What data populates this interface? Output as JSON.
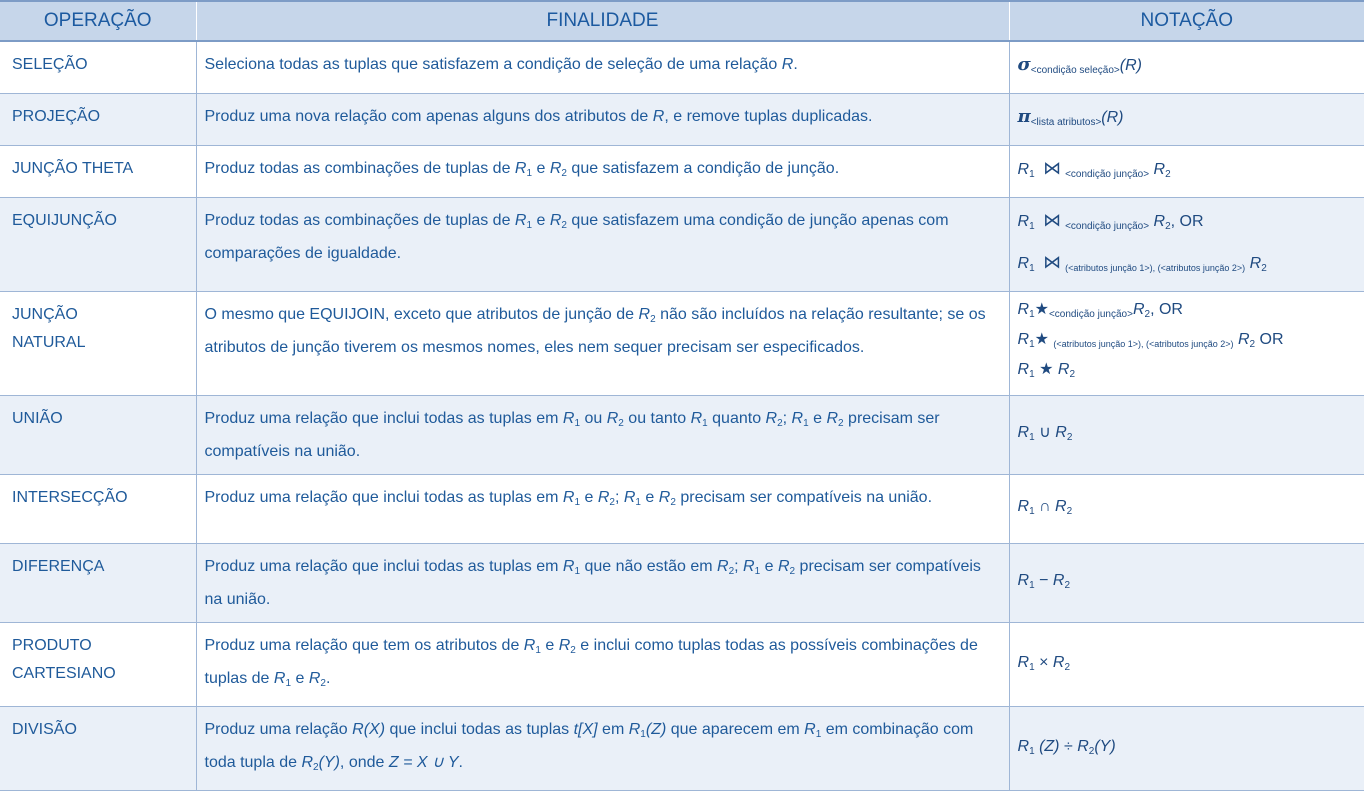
{
  "headers": {
    "operation": "OPERAÇÃO",
    "purpose": "FINALIDADE",
    "notation": "NOTAÇÃO"
  },
  "symbols": {
    "r": "R",
    "one": "1",
    "two": "2",
    "sigma": "σ",
    "pi": "π",
    "join": "⋈",
    "star": "★",
    "union": "∪",
    "intersect": "∩",
    "minus": "−",
    "times": "×",
    "div": "÷"
  },
  "rows": [
    {
      "op": "SELEÇÃO",
      "purpose": {
        "a": "Seleciona todas as tuplas que satisfazem a condição de seleção de uma relação ",
        "b": "."
      },
      "notation": {
        "sub": "<condição seleção>",
        "arg": "(R)"
      }
    },
    {
      "op": "PROJEÇÃO",
      "purpose": {
        "a": "Produz uma nova relação com apenas alguns dos atributos de ",
        "b": ", e remove tuplas duplicadas."
      },
      "notation": {
        "sub": "<lista atributos>",
        "arg": "(R)"
      }
    },
    {
      "op": "JUNÇÃO THETA",
      "purpose": {
        "a": "Produz todas as combinações de tuplas de ",
        "b": " e ",
        "c": " que satisfazem a condição de junção."
      },
      "notation": {
        "sub": "<condição junção>"
      }
    },
    {
      "op": "EQUIJUNÇÃO",
      "purpose": {
        "a": "Produz todas as combinações de tuplas de ",
        "b": " e ",
        "c": " que satisfazem uma condição de junção apenas com comparações de igualdade."
      },
      "notation": {
        "sub1": "<condição junção>",
        "or": ", OR",
        "sub2": "(<atributos junção 1>), (<atributos junção 2>)"
      }
    },
    {
      "op1": "JUNÇÃO",
      "op2": "NATURAL",
      "purpose": {
        "a": "O mesmo que EQUIJOIN, exceto que atributos de junção de ",
        "b": " não são incluídos na relação resultante; se os atributos de junção tiverem os mesmos nomes, eles nem sequer precisam ser especificados."
      },
      "notation": {
        "sub1": "<condição junção>",
        "or1": ", OR",
        "sub2": "(<atributos junção 1>), (<atributos junção 2>)",
        "or2": " OR"
      }
    },
    {
      "op": "UNIÃO",
      "purpose": {
        "a": "Produz uma relação que inclui todas as tuplas em ",
        "b": " ou ",
        "c": " ou tanto ",
        "d": " quanto ",
        "e": "; ",
        "f": " e ",
        "g": " precisam ser compatíveis na união."
      }
    },
    {
      "op": "INTERSECÇÃO",
      "purpose": {
        "a": "Produz uma relação que inclui todas as tuplas em ",
        "b": " e ",
        "c": "; ",
        "d": " e ",
        "e": " precisam ser compatíveis na união."
      }
    },
    {
      "op": "DIFERENÇA",
      "purpose": {
        "a": "Produz uma relação que inclui todas as tuplas em ",
        "b": " que não estão em ",
        "c": "; ",
        "d": " e ",
        "e": " precisam ser compatíveis na união."
      }
    },
    {
      "op1": "PRODUTO",
      "op2": "CARTESIANO",
      "purpose": {
        "a": "Produz uma relação que tem os atributos de ",
        "b": " e ",
        "c": " e inclui como tuplas todas as possíveis combinações de tuplas de ",
        "d": " e ",
        "e": "."
      }
    },
    {
      "op": "DIVISÃO",
      "purpose": {
        "a": "Produz uma relação ",
        "rx": "R(X)",
        "b": " que inclui todas as tuplas ",
        "tx": "t[X]",
        "c": " em ",
        "z": "(Z)",
        "d": " que aparecem em ",
        "e": " em combinação com toda tupla de ",
        "y": "(Y)",
        "f": ", onde ",
        "eq": "Z = X ∪ Y",
        "g": "."
      },
      "notation": {
        "z": " (Z) ",
        "y": "(Y)"
      }
    }
  ]
}
